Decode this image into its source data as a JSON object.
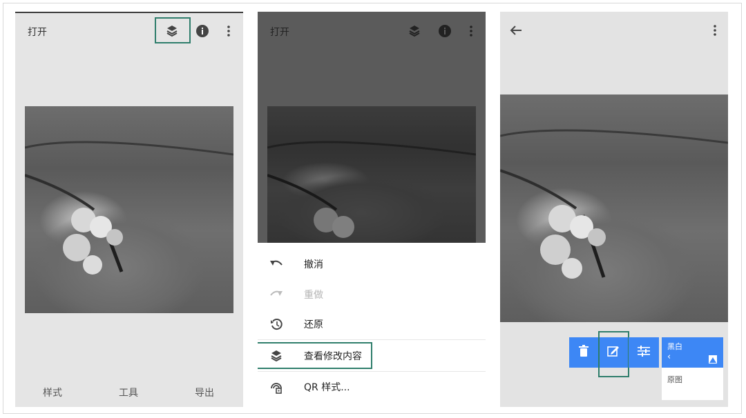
{
  "panel1": {
    "title": "打开",
    "tabs": [
      {
        "label": "样式"
      },
      {
        "label": "工具"
      },
      {
        "label": "导出"
      }
    ],
    "icons": [
      "layers-history-icon",
      "info-icon",
      "more-vert-icon"
    ]
  },
  "panel2": {
    "title": "打开",
    "menu": [
      {
        "label": "撤消",
        "icon": "undo-icon",
        "enabled": true
      },
      {
        "label": "重做",
        "icon": "redo-icon",
        "enabled": false
      },
      {
        "label": "还原",
        "icon": "restore-icon",
        "enabled": true
      },
      {
        "label": "查看修改内容",
        "icon": "layers-icon",
        "enabled": true
      },
      {
        "label": "QR 样式...",
        "icon": "qr-style-icon",
        "enabled": true
      }
    ]
  },
  "panel3": {
    "layers": [
      {
        "label": "黑白",
        "sub": "‹"
      },
      {
        "label": "原图"
      }
    ],
    "actions": [
      "delete-icon",
      "edit-brush-icon",
      "tune-icon"
    ]
  },
  "colors": {
    "accent": "#3d87f5",
    "highlight": "#2e7d6b"
  }
}
